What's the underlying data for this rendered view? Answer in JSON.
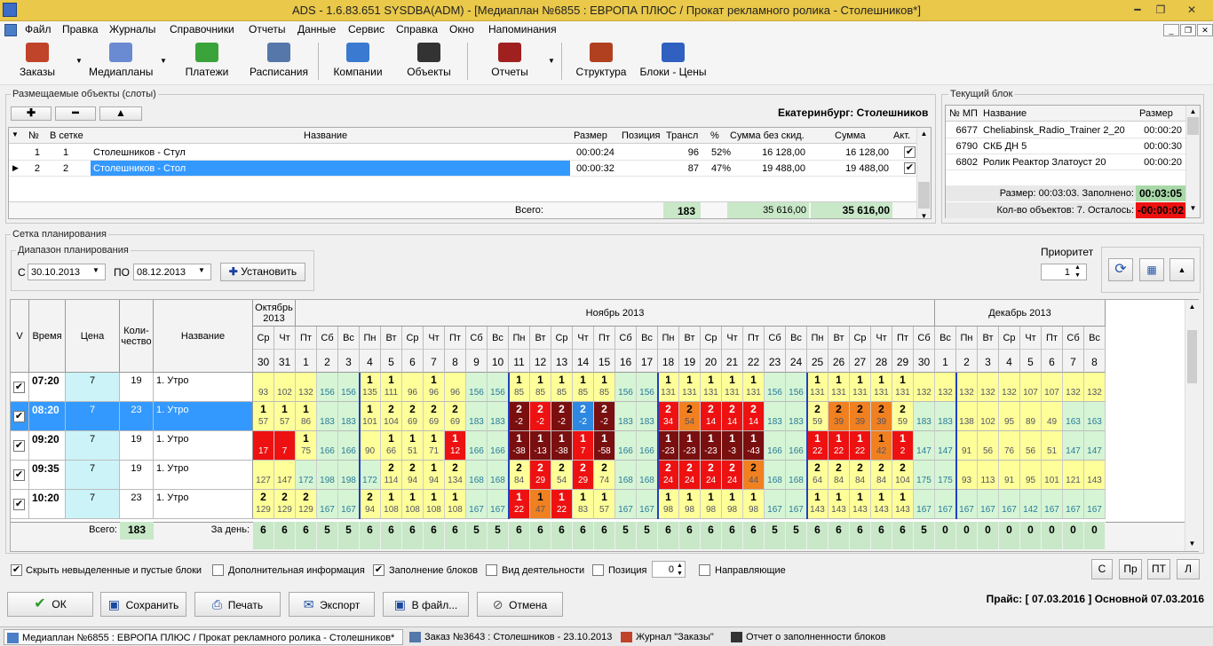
{
  "title": "ADS - 1.6.83.651 SYSDBA(ADM) - [Медиаплан №6855 :  ЕВРОПА ПЛЮС /  Прокат рекламного ролика - Столешников*]",
  "menu": [
    "Файл",
    "Правка",
    "Журналы",
    "Справочники",
    "Отчеты",
    "Данные",
    "Сервис",
    "Справка",
    "Окно",
    "Напоминания"
  ],
  "toolbar": [
    {
      "label": "Заказы",
      "icon": "briefcase-icon",
      "color": "#c0442a"
    },
    {
      "label": "Медиапланы",
      "icon": "mediaplan-icon",
      "color": "#6a8bd1"
    },
    {
      "label": "Платежи",
      "icon": "payment-icon",
      "color": "#3aa33a"
    },
    {
      "label": "Расписания",
      "icon": "schedule-icon",
      "color": "#5577aa"
    },
    {
      "label": "Компании",
      "icon": "companies-icon",
      "color": "#3a7ad0"
    },
    {
      "label": "Объекты",
      "icon": "objects-icon",
      "color": "#333333"
    },
    {
      "label": "Отчеты",
      "icon": "reports-icon",
      "color": "#a02020"
    },
    {
      "label": "Структура",
      "icon": "structure-icon",
      "color": "#b04020"
    },
    {
      "label": "Блоки - Цены",
      "icon": "blocks-prices-icon",
      "color": "#3060c0"
    }
  ],
  "slots": {
    "title": "Размещаемые объекты (слоты)",
    "city": "Екатеринбург:  Столешников",
    "columns": [
      "№",
      "В сетке",
      "Название",
      "Размер",
      "Позиция",
      "Трансл",
      "%",
      "Сумма без скид.",
      "Сумма",
      "Акт."
    ],
    "rows": [
      {
        "no": "1",
        "grid": "1",
        "name": "Столешников - Стул",
        "size": "00:00:24",
        "pos": "",
        "trans": "96",
        "pct": "52%",
        "sum_nd": "16 128,00",
        "sum": "16 128,00",
        "act": true
      },
      {
        "no": "2",
        "grid": "2",
        "name": "Столешников - Стол",
        "size": "00:00:32",
        "pos": "",
        "trans": "87",
        "pct": "47%",
        "sum_nd": "19 488,00",
        "sum": "19 488,00",
        "act": true
      }
    ],
    "total_label": "Всего:",
    "total_trans": "183",
    "total_sum_nd": "35 616,00",
    "total_sum": "35 616,00"
  },
  "current_block": {
    "title": "Текущий блок",
    "columns": [
      "№ МП",
      "Название",
      "Размер"
    ],
    "rows": [
      [
        "6677",
        "Cheliabinsk_Radio_Trainer 2_20",
        "00:00:20"
      ],
      [
        "6790",
        "СКБ ДН 5",
        "00:00:30"
      ],
      [
        "6802",
        "Ролик Реактор Златоуст 20",
        "00:00:20"
      ]
    ],
    "size_label": "Размер: 00:03:03. Заполнено:",
    "size_value": "00:03:05",
    "count_label": "Кол-во объектов: 7. Осталось:",
    "count_value": "-00:00:02"
  },
  "planning": {
    "title": "Сетка планирования",
    "range_title": "Диапазон планирования",
    "from_label": "С",
    "from": "30.10.2013",
    "to_label": "ПО",
    "to": "08.12.2013",
    "set_button": "Установить",
    "priority_label": "Приоритет",
    "priority": "1"
  },
  "sched": {
    "hdr": {
      "v": "V",
      "time": "Время",
      "price": "Цена",
      "qty": "Коли-\nчество",
      "name": "Название"
    },
    "months": [
      {
        "name": "Октябрь 2013",
        "span": 2
      },
      {
        "name": "Ноябрь 2013",
        "span": 30
      },
      {
        "name": "Декабрь 2013",
        "span": 8
      }
    ],
    "days": [
      "Ср",
      "Чт",
      "Пт",
      "Сб",
      "Вс",
      "Пн",
      "Вт",
      "Ср",
      "Чт",
      "Пт",
      "Сб",
      "Вс",
      "Пн",
      "Вт",
      "Ср",
      "Чт",
      "Пт",
      "Сб",
      "Вс",
      "Пн",
      "Вт",
      "Ср",
      "Чт",
      "Пт",
      "Сб",
      "Вс",
      "Пн",
      "Вт",
      "Ср",
      "Чт",
      "Пт",
      "Сб",
      "Вс",
      "Пн",
      "Вт",
      "Ср",
      "Чт",
      "Пт",
      "Сб",
      "Вс"
    ],
    "dates": [
      "30",
      "31",
      "1",
      "2",
      "3",
      "4",
      "5",
      "6",
      "7",
      "8",
      "9",
      "10",
      "11",
      "12",
      "13",
      "14",
      "15",
      "16",
      "17",
      "18",
      "19",
      "20",
      "21",
      "22",
      "23",
      "24",
      "25",
      "26",
      "27",
      "28",
      "29",
      "30",
      "1",
      "2",
      "3",
      "4",
      "5",
      "6",
      "7",
      "8"
    ],
    "rows": [
      {
        "time": "07:20",
        "price": "7",
        "qty": "19",
        "name": "1. Утро",
        "checked": true,
        "top": [
          "",
          "",
          "",
          "",
          "",
          "1",
          "1",
          "",
          "1",
          "",
          "",
          "",
          "1",
          "1",
          "1",
          "1",
          "1",
          "",
          "",
          "1",
          "1",
          "1",
          "1",
          "1",
          "",
          "",
          "1",
          "1",
          "1",
          "1",
          "1",
          "",
          "",
          "",
          "",
          "",
          "",
          "",
          "",
          ""
        ],
        "bot": [
          "93",
          "102",
          "132",
          "156",
          "156",
          "135",
          "111",
          "96",
          "96",
          "96",
          "156",
          "156",
          "85",
          "85",
          "85",
          "85",
          "85",
          "156",
          "156",
          "131",
          "131",
          "131",
          "131",
          "131",
          "156",
          "156",
          "131",
          "131",
          "131",
          "131",
          "131",
          "132",
          "132",
          "132",
          "132",
          "132",
          "107",
          "107",
          "132",
          "132"
        ],
        "col": [
          "y",
          "y",
          "y",
          "g",
          "g",
          "y",
          "y",
          "y",
          "y",
          "y",
          "g",
          "g",
          "y",
          "y",
          "y",
          "y",
          "y",
          "g",
          "g",
          "y",
          "y",
          "y",
          "y",
          "y",
          "g",
          "g",
          "y",
          "y",
          "y",
          "y",
          "y",
          "y",
          "y",
          "y",
          "y",
          "y",
          "y",
          "y",
          "y",
          "y"
        ]
      },
      {
        "time": "08:20",
        "price": "7",
        "qty": "23",
        "name": "1. Утро",
        "checked": true,
        "selected": true,
        "top": [
          "1",
          "1",
          "1",
          "",
          "",
          "1",
          "2",
          "2",
          "2",
          "2",
          "",
          "",
          "2",
          "2",
          "2",
          "2",
          "2",
          "",
          "",
          "2",
          "2",
          "2",
          "2",
          "2",
          "",
          "",
          "2",
          "2",
          "2",
          "2",
          "2",
          "",
          "",
          "",
          "",
          "",
          "",
          "",
          "",
          ""
        ],
        "bot": [
          "57",
          "57",
          "86",
          "183",
          "183",
          "101",
          "104",
          "69",
          "69",
          "69",
          "183",
          "183",
          "-2",
          "-2",
          "-2",
          "-2",
          "-2",
          "183",
          "183",
          "34",
          "54",
          "14",
          "14",
          "14",
          "183",
          "183",
          "59",
          "39",
          "39",
          "39",
          "59",
          "183",
          "183",
          "138",
          "102",
          "95",
          "89",
          "49",
          "163",
          "163"
        ],
        "col": [
          "y",
          "y",
          "y",
          "g",
          "g",
          "y",
          "y",
          "y",
          "y",
          "y",
          "g",
          "g",
          "dr",
          "r",
          "dr",
          "b",
          "dr",
          "g",
          "g",
          "r",
          "o",
          "r",
          "r",
          "r",
          "g",
          "g",
          "y",
          "o",
          "o",
          "o",
          "y",
          "g",
          "g",
          "y",
          "y",
          "y",
          "y",
          "y",
          "g",
          "g"
        ]
      },
      {
        "time": "09:20",
        "price": "7",
        "qty": "19",
        "name": "1. Утро",
        "checked": true,
        "top": [
          "",
          "",
          "1",
          "",
          "",
          "",
          "1",
          "1",
          "1",
          "1",
          "",
          "",
          "1",
          "1",
          "1",
          "1",
          "1",
          "",
          "",
          "1",
          "1",
          "1",
          "1",
          "1",
          "",
          "",
          "1",
          "1",
          "1",
          "1",
          "1",
          "",
          "",
          "",
          "",
          "",
          "",
          "",
          "",
          ""
        ],
        "bot": [
          "17",
          "7",
          "75",
          "166",
          "166",
          "90",
          "66",
          "51",
          "71",
          "12",
          "166",
          "166",
          "-38",
          "-13",
          "-38",
          "7",
          "-58",
          "166",
          "166",
          "-23",
          "-23",
          "-23",
          "-3",
          "-43",
          "166",
          "166",
          "22",
          "22",
          "22",
          "42",
          "2",
          "147",
          "147",
          "91",
          "56",
          "76",
          "56",
          "51",
          "147",
          "147"
        ],
        "col": [
          "r",
          "r",
          "y",
          "g",
          "g",
          "y",
          "y",
          "y",
          "y",
          "r",
          "g",
          "g",
          "dr",
          "dr",
          "dr",
          "r",
          "dr",
          "g",
          "g",
          "dr",
          "dr",
          "dr",
          "dr",
          "dr",
          "g",
          "g",
          "r",
          "r",
          "r",
          "o",
          "r",
          "g",
          "g",
          "y",
          "y",
          "y",
          "y",
          "y",
          "g",
          "g"
        ]
      },
      {
        "time": "09:35",
        "price": "7",
        "qty": "19",
        "name": "1. Утро",
        "checked": true,
        "top": [
          "",
          "",
          "",
          "",
          "",
          "",
          "2",
          "2",
          "1",
          "2",
          "",
          "",
          "2",
          "2",
          "2",
          "2",
          "2",
          "",
          "",
          "2",
          "2",
          "2",
          "2",
          "2",
          "",
          "",
          "2",
          "2",
          "2",
          "2",
          "2",
          "",
          "",
          "",
          "",
          "",
          "",
          "",
          "",
          ""
        ],
        "bot": [
          "127",
          "147",
          "172",
          "198",
          "198",
          "172",
          "114",
          "94",
          "94",
          "134",
          "168",
          "168",
          "84",
          "29",
          "54",
          "29",
          "74",
          "168",
          "168",
          "24",
          "24",
          "24",
          "24",
          "44",
          "168",
          "168",
          "64",
          "84",
          "84",
          "84",
          "104",
          "175",
          "175",
          "93",
          "113",
          "91",
          "95",
          "101",
          "121",
          "143"
        ],
        "col": [
          "y",
          "y",
          "g",
          "g",
          "g",
          "g",
          "y",
          "y",
          "y",
          "y",
          "g",
          "g",
          "y",
          "r",
          "y",
          "r",
          "y",
          "g",
          "g",
          "r",
          "r",
          "r",
          "r",
          "o",
          "g",
          "g",
          "y",
          "y",
          "y",
          "y",
          "y",
          "g",
          "g",
          "y",
          "y",
          "y",
          "y",
          "y",
          "y",
          "y"
        ]
      },
      {
        "time": "10:20",
        "price": "7",
        "qty": "23",
        "name": "1. Утро",
        "checked": true,
        "top": [
          "2",
          "2",
          "2",
          "",
          "",
          "2",
          "1",
          "1",
          "1",
          "1",
          "",
          "",
          "1",
          "1",
          "1",
          "1",
          "1",
          "",
          "",
          "1",
          "1",
          "1",
          "1",
          "1",
          "",
          "",
          "1",
          "1",
          "1",
          "1",
          "1",
          "",
          "",
          "",
          "",
          "",
          "",
          "",
          "",
          ""
        ],
        "bot": [
          "129",
          "129",
          "129",
          "167",
          "167",
          "94",
          "108",
          "108",
          "108",
          "108",
          "167",
          "167",
          "22",
          "47",
          "22",
          "83",
          "57",
          "167",
          "167",
          "98",
          "98",
          "98",
          "98",
          "98",
          "167",
          "167",
          "143",
          "143",
          "143",
          "143",
          "143",
          "167",
          "167",
          "167",
          "167",
          "167",
          "142",
          "167",
          "167",
          "167"
        ],
        "col": [
          "y",
          "y",
          "y",
          "g",
          "g",
          "y",
          "y",
          "y",
          "y",
          "y",
          "g",
          "g",
          "r",
          "o",
          "r",
          "y",
          "y",
          "g",
          "g",
          "y",
          "y",
          "y",
          "y",
          "y",
          "g",
          "g",
          "y",
          "y",
          "y",
          "y",
          "y",
          "g",
          "g",
          "g",
          "g",
          "g",
          "g",
          "g",
          "g",
          "g"
        ]
      }
    ],
    "footer_total_label": "Всего:",
    "footer_total": "183",
    "footer_day_label": "За день:",
    "per_day": [
      "6",
      "6",
      "6",
      "5",
      "5",
      "6",
      "6",
      "6",
      "6",
      "6",
      "5",
      "5",
      "6",
      "6",
      "6",
      "6",
      "6",
      "5",
      "5",
      "6",
      "6",
      "6",
      "6",
      "6",
      "5",
      "5",
      "6",
      "6",
      "6",
      "6",
      "6",
      "5",
      "0",
      "0",
      "0",
      "0",
      "0",
      "0",
      "0",
      "0"
    ]
  },
  "options": {
    "hide_empty": "Скрыть невыделенные и пустые блоки",
    "extra_info": "Дополнительная информация",
    "fill_blocks": "Заполнение блоков",
    "activity": "Вид деятельности",
    "position": "Позиция",
    "position_value": "0",
    "guides": "Направляющие",
    "small_btns": [
      "С",
      "Пр",
      "ПТ",
      "Л"
    ]
  },
  "actions": {
    "ok": "ОК",
    "save": "Сохранить",
    "print": "Печать",
    "export": "Экспорт",
    "tofile": "В файл...",
    "cancel": "Отмена"
  },
  "price_info": "Прайс: [ 07.03.2016 ] Основной 07.03.2016",
  "taskbar": [
    {
      "label": "Медиаплан №6855 :  ЕВРОПА ПЛЮС /  Прокат рекламного ролика - Столешников*",
      "icon": "mediaplan-task-icon"
    },
    {
      "label": "Заказ №3643 : Столешников - 23.10.2013",
      "icon": "order-task-icon"
    },
    {
      "label": "Журнал \"Заказы\"",
      "icon": "journal-task-icon"
    },
    {
      "label": "Отчет о заполненности блоков",
      "icon": "report-task-icon"
    }
  ],
  "colors": {
    "y": "#ffff99",
    "g": "#d5f5d5",
    "r": "#ee1111",
    "dr": "#7a0f0f",
    "o": "#f08020",
    "b": "#2e87e0",
    "sel": "#3399ff",
    "sum": "#c8e8c8"
  }
}
